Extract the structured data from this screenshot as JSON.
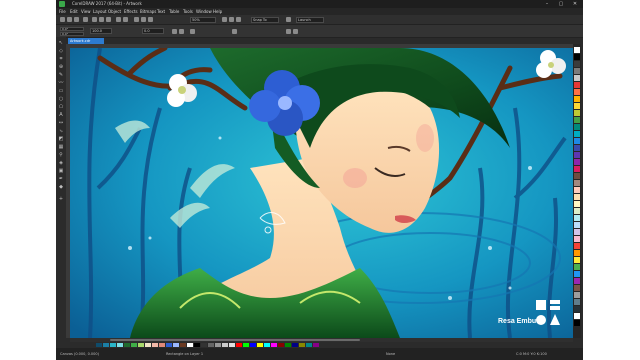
{
  "window": {
    "title": "CorelDRAW 2017 (64-Bit) - Artwork",
    "controls": [
      "–",
      "▢",
      "✕"
    ]
  },
  "menu": [
    "File",
    "Edit",
    "View",
    "Layout",
    "Object",
    "Effects",
    "Bitmaps",
    "Text",
    "Table",
    "Tools",
    "Window",
    "Help"
  ],
  "toolbar": {
    "zoom_value": "50%",
    "snap_label": "Snap To",
    "launch_label": "Launch",
    "width_value": "0.0\"",
    "height_value": "0.0\"",
    "size_value": "100.0",
    "angle_value": "0.0"
  },
  "document_tab": "Artwork.cdr",
  "artwork": {
    "signature": "Resa Embutin"
  },
  "palette_colors": [
    "#ffffff",
    "#000000",
    "#3b3b3b",
    "#7a7a7a",
    "#c8c8c8",
    "#e53935",
    "#ff7043",
    "#ffb300",
    "#fdd835",
    "#c0ca33",
    "#43a047",
    "#00897b",
    "#00acc1",
    "#1e88e5",
    "#3949ab",
    "#5e35b1",
    "#8e24aa",
    "#d81b60",
    "#6d4c41",
    "#a1887f",
    "#ffccbc",
    "#ffe0b2",
    "#fff9c4",
    "#dcedc8",
    "#b2ebf2",
    "#bbdefb",
    "#d1c4e9",
    "#f8bbd0",
    "#f44336",
    "#ff9800",
    "#ffeb3b",
    "#4caf50",
    "#2196f3",
    "#9c27b0",
    "#795548",
    "#9e9e9e",
    "#607d8b",
    "#263238",
    "#ffffff",
    "#000000"
  ],
  "doc_palette_colors": [
    "#0f4c6b",
    "#1b7fa6",
    "#2ab6c9",
    "#7ee0e6",
    "#1f6b2e",
    "#3fae47",
    "#a8d86b",
    "#f3e3c6",
    "#f1b8a8",
    "#e08a7a",
    "#2d5ed3",
    "#9ab8ff",
    "#6b3a22",
    "#ffffff",
    "#000000",
    "#333333",
    "#666666",
    "#999999",
    "#cccccc",
    "#e0e0e0",
    "#ff0000",
    "#00ff00",
    "#0000ff",
    "#ffff00",
    "#00ffff",
    "#ff00ff",
    "#880000",
    "#008800",
    "#000088",
    "#888800",
    "#008888",
    "#880088"
  ],
  "status": {
    "left": "Canvas (0.000, 0.000)",
    "mid1": "Rectangle on Layer 1",
    "mid2": "None",
    "right": "C:0 M:0 Y:0 K:100"
  }
}
